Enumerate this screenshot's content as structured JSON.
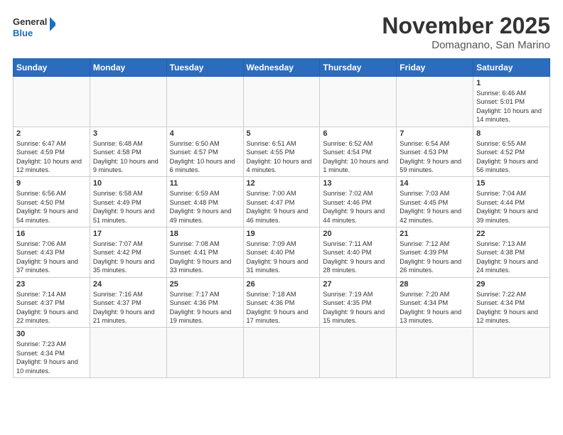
{
  "header": {
    "logo_general": "General",
    "logo_blue": "Blue",
    "month": "November 2025",
    "location": "Domagnano, San Marino"
  },
  "weekdays": [
    "Sunday",
    "Monday",
    "Tuesday",
    "Wednesday",
    "Thursday",
    "Friday",
    "Saturday"
  ],
  "weeks": [
    [
      {
        "day": "",
        "info": ""
      },
      {
        "day": "",
        "info": ""
      },
      {
        "day": "",
        "info": ""
      },
      {
        "day": "",
        "info": ""
      },
      {
        "day": "",
        "info": ""
      },
      {
        "day": "",
        "info": ""
      },
      {
        "day": "1",
        "info": "Sunrise: 6:46 AM\nSunset: 5:01 PM\nDaylight: 10 hours and 14 minutes."
      }
    ],
    [
      {
        "day": "2",
        "info": "Sunrise: 6:47 AM\nSunset: 4:59 PM\nDaylight: 10 hours and 12 minutes."
      },
      {
        "day": "3",
        "info": "Sunrise: 6:48 AM\nSunset: 4:58 PM\nDaylight: 10 hours and 9 minutes."
      },
      {
        "day": "4",
        "info": "Sunrise: 6:50 AM\nSunset: 4:57 PM\nDaylight: 10 hours and 6 minutes."
      },
      {
        "day": "5",
        "info": "Sunrise: 6:51 AM\nSunset: 4:55 PM\nDaylight: 10 hours and 4 minutes."
      },
      {
        "day": "6",
        "info": "Sunrise: 6:52 AM\nSunset: 4:54 PM\nDaylight: 10 hours and 1 minute."
      },
      {
        "day": "7",
        "info": "Sunrise: 6:54 AM\nSunset: 4:53 PM\nDaylight: 9 hours and 59 minutes."
      },
      {
        "day": "8",
        "info": "Sunrise: 6:55 AM\nSunset: 4:52 PM\nDaylight: 9 hours and 56 minutes."
      }
    ],
    [
      {
        "day": "9",
        "info": "Sunrise: 6:56 AM\nSunset: 4:50 PM\nDaylight: 9 hours and 54 minutes."
      },
      {
        "day": "10",
        "info": "Sunrise: 6:58 AM\nSunset: 4:49 PM\nDaylight: 9 hours and 51 minutes."
      },
      {
        "day": "11",
        "info": "Sunrise: 6:59 AM\nSunset: 4:48 PM\nDaylight: 9 hours and 49 minutes."
      },
      {
        "day": "12",
        "info": "Sunrise: 7:00 AM\nSunset: 4:47 PM\nDaylight: 9 hours and 46 minutes."
      },
      {
        "day": "13",
        "info": "Sunrise: 7:02 AM\nSunset: 4:46 PM\nDaylight: 9 hours and 44 minutes."
      },
      {
        "day": "14",
        "info": "Sunrise: 7:03 AM\nSunset: 4:45 PM\nDaylight: 9 hours and 42 minutes."
      },
      {
        "day": "15",
        "info": "Sunrise: 7:04 AM\nSunset: 4:44 PM\nDaylight: 9 hours and 39 minutes."
      }
    ],
    [
      {
        "day": "16",
        "info": "Sunrise: 7:06 AM\nSunset: 4:43 PM\nDaylight: 9 hours and 37 minutes."
      },
      {
        "day": "17",
        "info": "Sunrise: 7:07 AM\nSunset: 4:42 PM\nDaylight: 9 hours and 35 minutes."
      },
      {
        "day": "18",
        "info": "Sunrise: 7:08 AM\nSunset: 4:41 PM\nDaylight: 9 hours and 33 minutes."
      },
      {
        "day": "19",
        "info": "Sunrise: 7:09 AM\nSunset: 4:40 PM\nDaylight: 9 hours and 31 minutes."
      },
      {
        "day": "20",
        "info": "Sunrise: 7:11 AM\nSunset: 4:40 PM\nDaylight: 9 hours and 28 minutes."
      },
      {
        "day": "21",
        "info": "Sunrise: 7:12 AM\nSunset: 4:39 PM\nDaylight: 9 hours and 26 minutes."
      },
      {
        "day": "22",
        "info": "Sunrise: 7:13 AM\nSunset: 4:38 PM\nDaylight: 9 hours and 24 minutes."
      }
    ],
    [
      {
        "day": "23",
        "info": "Sunrise: 7:14 AM\nSunset: 4:37 PM\nDaylight: 9 hours and 22 minutes."
      },
      {
        "day": "24",
        "info": "Sunrise: 7:16 AM\nSunset: 4:37 PM\nDaylight: 9 hours and 21 minutes."
      },
      {
        "day": "25",
        "info": "Sunrise: 7:17 AM\nSunset: 4:36 PM\nDaylight: 9 hours and 19 minutes."
      },
      {
        "day": "26",
        "info": "Sunrise: 7:18 AM\nSunset: 4:36 PM\nDaylight: 9 hours and 17 minutes."
      },
      {
        "day": "27",
        "info": "Sunrise: 7:19 AM\nSunset: 4:35 PM\nDaylight: 9 hours and 15 minutes."
      },
      {
        "day": "28",
        "info": "Sunrise: 7:20 AM\nSunset: 4:34 PM\nDaylight: 9 hours and 13 minutes."
      },
      {
        "day": "29",
        "info": "Sunrise: 7:22 AM\nSunset: 4:34 PM\nDaylight: 9 hours and 12 minutes."
      }
    ],
    [
      {
        "day": "30",
        "info": "Sunrise: 7:23 AM\nSunset: 4:34 PM\nDaylight: 9 hours and 10 minutes."
      },
      {
        "day": "",
        "info": ""
      },
      {
        "day": "",
        "info": ""
      },
      {
        "day": "",
        "info": ""
      },
      {
        "day": "",
        "info": ""
      },
      {
        "day": "",
        "info": ""
      },
      {
        "day": "",
        "info": ""
      }
    ]
  ]
}
